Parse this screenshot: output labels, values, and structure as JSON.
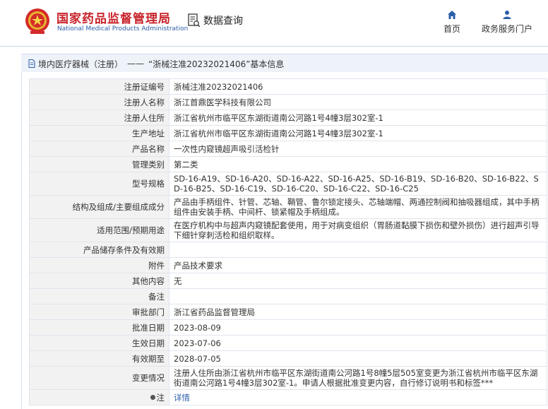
{
  "header": {
    "brand_cn": "国家药品监督管理局",
    "brand_en": "National Medical Products Administration",
    "query_label": "数据查询",
    "nav_home": "首页",
    "nav_portal": "政务服务门户",
    "brand_color": "#c8242b",
    "link_color": "#2a5ea8"
  },
  "breadcrumb": {
    "category": "境内医疗器械（注册）",
    "separator": "——",
    "title": "“浙械注准20232021406”基本信息"
  },
  "rows": [
    {
      "label": "注册证编号",
      "value": "浙械注准20232021406"
    },
    {
      "label": "注册人名称",
      "value": "浙江首鼎医学科技有限公司"
    },
    {
      "label": "注册人住所",
      "value": "浙江省杭州市临平区东湖街道南公河路1号4幢3层302室-1"
    },
    {
      "label": "生产地址",
      "value": "浙江省杭州市临平区东湖街道南公河路1号4幢3层302室-1"
    },
    {
      "label": "产品名称",
      "value": "一次性内窥镜超声吸引活检针"
    },
    {
      "label": "管理类别",
      "value": "第二类"
    },
    {
      "label": "型号规格",
      "value": "SD-16-A19、SD-16-A20、SD-16-A22、SD-16-A25、SD-16-B19、SD-16-B20、SD-16-B22、SD-16-B25、SD-16-C19、SD-16-C20、SD-16-C22、SD-16-C25"
    },
    {
      "label": "结构及组成/主要组成成分",
      "value": "产品由手柄组件、针管、芯轴、鞘管、鲁尔锁定接头、芯轴端帽、两通控制阀和抽吸器组成，其中手柄组件由安装手柄、中间杆、锁紧帽及手柄组成。"
    },
    {
      "label": "适用范围/预期用途",
      "value": "在医疗机构中与超声内窥镜配套使用，用于对病变组织（胃肠道黏膜下损伤和壁外损伤）进行超声引导下细针穿刺活检和组织取样。"
    },
    {
      "label": "产品储存条件及有效期",
      "value": ""
    },
    {
      "label": "附件",
      "value": "产品技术要求"
    },
    {
      "label": "其他内容",
      "value": "无"
    },
    {
      "label": "备注",
      "value": ""
    },
    {
      "label": "审批部门",
      "value": "浙江省药品监督管理局"
    },
    {
      "label": "批准日期",
      "value": "2023-08-09"
    },
    {
      "label": "生效日期",
      "value": "2023-07-06"
    },
    {
      "label": "有效期至",
      "value": "2028-07-05"
    },
    {
      "label": "变更情况",
      "value": "注册人住所由浙江省杭州市临平区东湖街道南公河路1号8幢5层505室变更为浙江省杭州市临平区东湖街道南公河路1号4幢3层302室-1。申请人根据批准变更内容，自行修订说明书和标签***"
    }
  ],
  "note": {
    "label": "注",
    "link": "详情"
  }
}
